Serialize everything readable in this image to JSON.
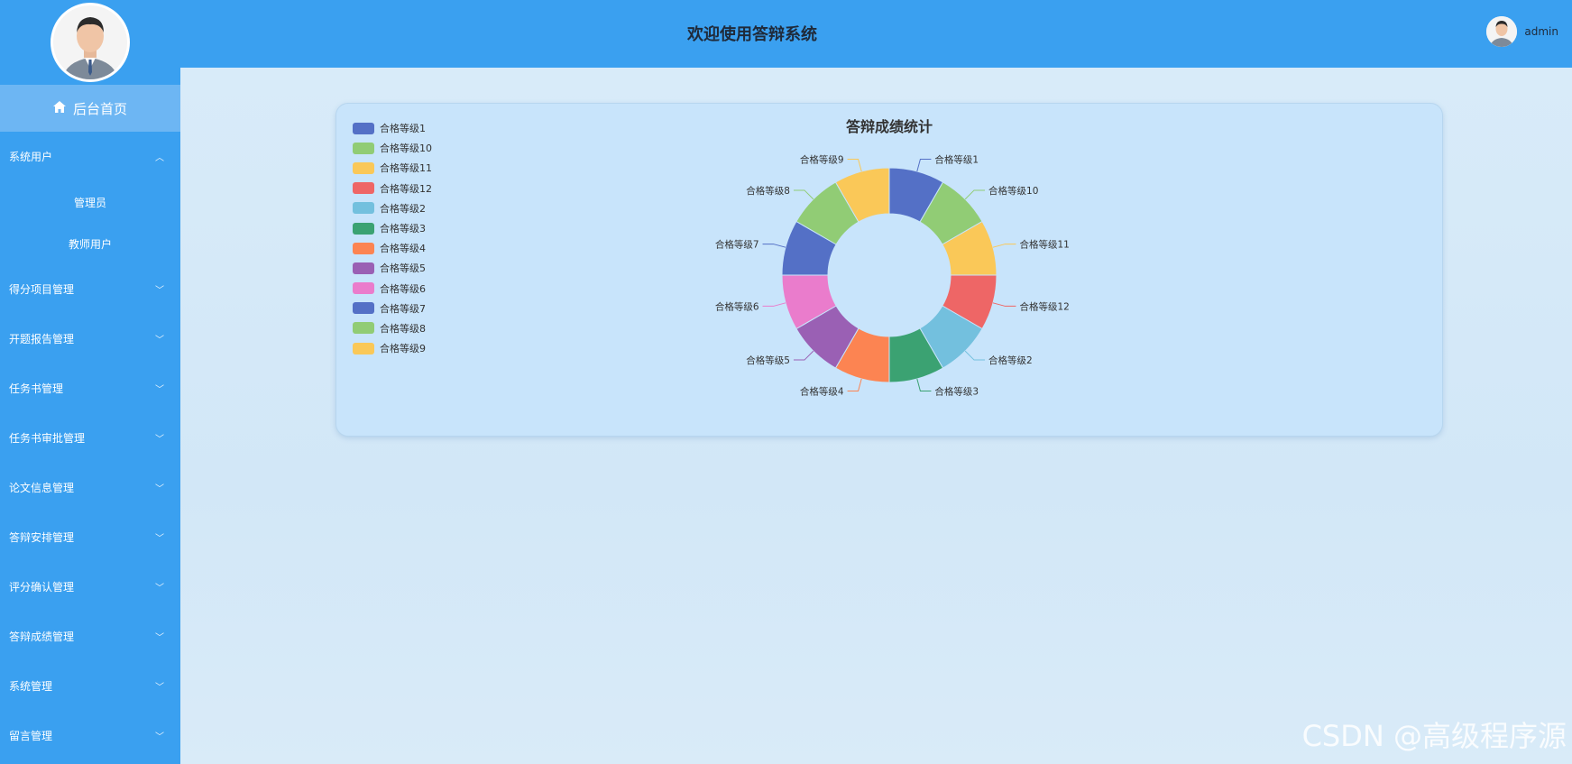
{
  "app": {
    "header_title": "欢迎使用答辩系统",
    "user_name": "admin",
    "watermark": "CSDN @高级程序源"
  },
  "sidebar": {
    "home_label": "后台首页",
    "groups": [
      {
        "label": "系统用户",
        "expanded": true,
        "children": [
          "管理员",
          "教师用户"
        ]
      },
      {
        "label": "得分项目管理",
        "expanded": false
      },
      {
        "label": "开题报告管理",
        "expanded": false
      },
      {
        "label": "任务书管理",
        "expanded": false
      },
      {
        "label": "任务书审批管理",
        "expanded": false
      },
      {
        "label": "论文信息管理",
        "expanded": false
      },
      {
        "label": "答辩安排管理",
        "expanded": false
      },
      {
        "label": "评分确认管理",
        "expanded": false
      },
      {
        "label": "答辩成绩管理",
        "expanded": false
      },
      {
        "label": "系统管理",
        "expanded": false
      },
      {
        "label": "留言管理",
        "expanded": false
      }
    ]
  },
  "colors": {
    "sidebar_bg": "#3aa0f0",
    "header_bg": "#3aa0f0",
    "card_bg": "#c8e4fb"
  },
  "chart_data": {
    "type": "pie",
    "subtype": "donut",
    "title": "答辩成绩统计",
    "legend_position": "top-left",
    "categories": [
      "合格等级1",
      "合格等级10",
      "合格等级11",
      "合格等级12",
      "合格等级2",
      "合格等级3",
      "合格等级4",
      "合格等级5",
      "合格等级6",
      "合格等级7",
      "合格等级8",
      "合格等级9"
    ],
    "values": [
      1,
      1,
      1,
      1,
      1,
      1,
      1,
      1,
      1,
      1,
      1,
      1
    ],
    "colors": [
      "#5470c6",
      "#91cc75",
      "#fac858",
      "#ee6666",
      "#73c0de",
      "#3ba272",
      "#fc8452",
      "#9a60b4",
      "#ea7ccc",
      "#5470c6",
      "#91cc75",
      "#fac858"
    ]
  }
}
